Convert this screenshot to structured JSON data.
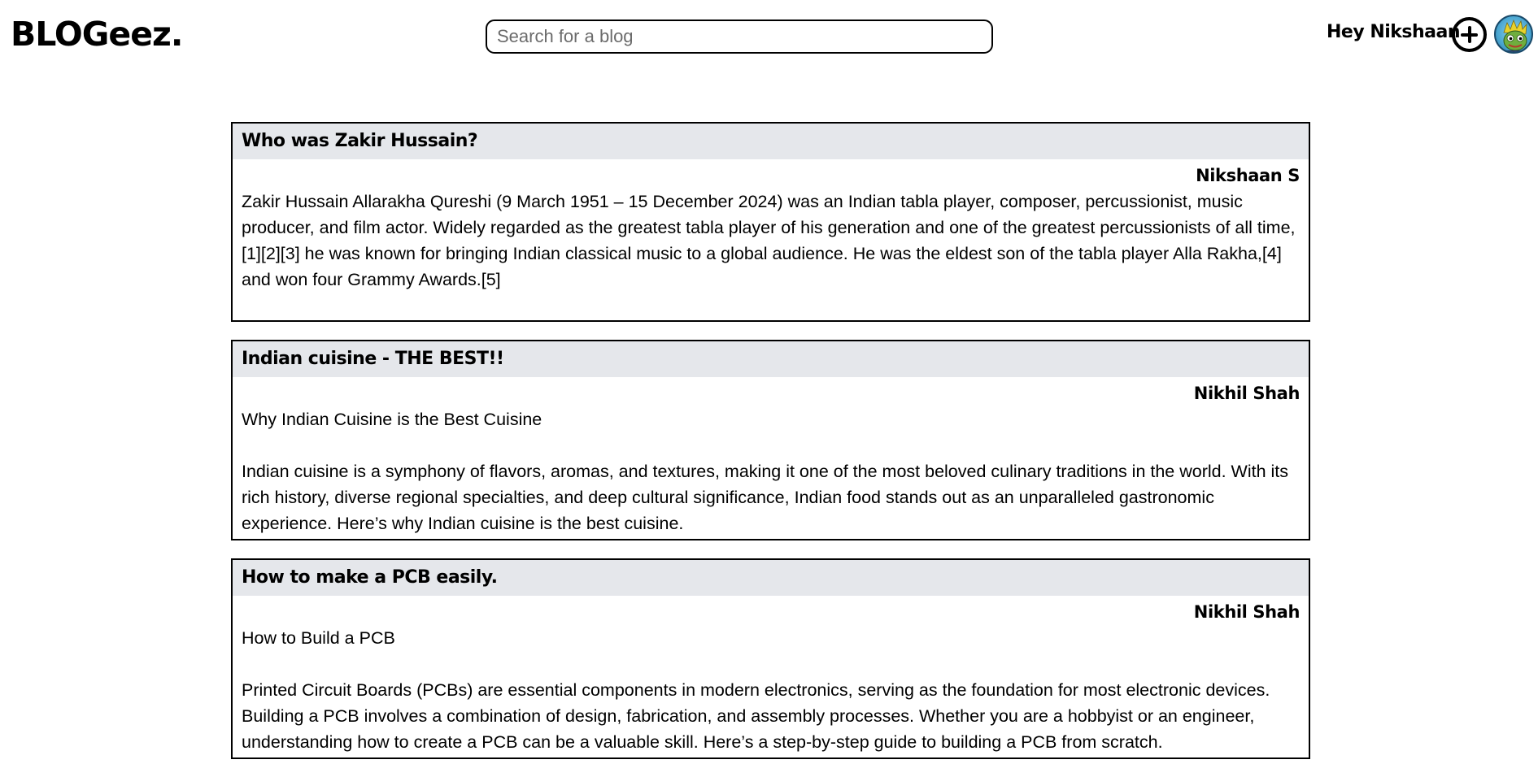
{
  "header": {
    "logo": "BLOGeez.",
    "search_placeholder": "Search for a blog",
    "greeting": "Hey Nikshaan",
    "add_icon": "plus-circle-icon",
    "avatar_icon": "avatar-image"
  },
  "posts": [
    {
      "title": "Who was Zakir Hussain?",
      "author": "Nikshaan S",
      "body": "Zakir Hussain Allarakha Qureshi (9 March 1951 – 15 December 2024) was an Indian tabla player, composer, percussionist, music producer, and film actor. Widely regarded as the greatest tabla player of his generation and one of the greatest percussionists of all time,[1][2][3] he was known for bringing Indian classical music to a global audience. He was the eldest son of the tabla player Alla Rakha,[4] and won four Grammy Awards.[5]"
    },
    {
      "title": "Indian cuisine - THE BEST!!",
      "author": "Nikhil Shah",
      "body": "Why Indian Cuisine is the Best Cuisine\n\nIndian cuisine is a symphony of flavors, aromas, and textures, making it one of the most beloved culinary traditions in the world. With its rich history, diverse regional specialties, and deep cultural significance, Indian food stands out as an unparalleled gastronomic experience. Here’s why Indian cuisine is the best cuisine."
    },
    {
      "title": "How to make a PCB easily.",
      "author": "Nikhil Shah",
      "body": "How to Build a PCB\n\nPrinted Circuit Boards (PCBs) are essential components in modern electronics, serving as the foundation for most electronic devices. Building a PCB involves a combination of design, fabrication, and assembly processes. Whether you are a hobbyist or an engineer, understanding how to create a PCB can be a valuable skill. Here’s a step-by-step guide to building a PCB from scratch."
    }
  ]
}
